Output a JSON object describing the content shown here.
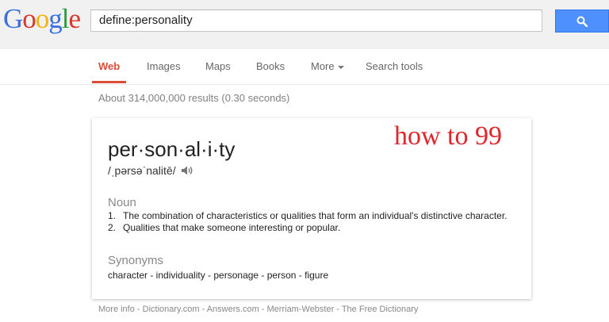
{
  "logo": {
    "text": "Google",
    "letters": [
      {
        "char": "G",
        "color": "#3b6fe0"
      },
      {
        "char": "o",
        "color": "#d9382d"
      },
      {
        "char": "o",
        "color": "#f2b50f"
      },
      {
        "char": "g",
        "color": "#3b6fe0"
      },
      {
        "char": "l",
        "color": "#2a9d3d"
      },
      {
        "char": "e",
        "color": "#d9382d"
      }
    ]
  },
  "search": {
    "query": "define:personality",
    "button_icon": "search-icon"
  },
  "tabs": [
    {
      "label": "Web",
      "active": true
    },
    {
      "label": "Images",
      "active": false
    },
    {
      "label": "Maps",
      "active": false
    },
    {
      "label": "Books",
      "active": false
    },
    {
      "label": "More",
      "active": false,
      "icon": "caret-down-icon"
    },
    {
      "label": "Search tools",
      "active": false
    }
  ],
  "result_stats": "About 314,000,000 results (0.30 seconds)",
  "definition": {
    "word": "per·son·al·i·ty",
    "pronunciation": "/ˌpərsəˈnalitē/",
    "speaker_icon": "speaker-icon",
    "part_of_speech": "Noun",
    "definitions": [
      {
        "num": "1.",
        "text": "The combination of characteristics or qualities that form an individual's distinctive character."
      },
      {
        "num": "2.",
        "text": "Qualities that make someone interesting or popular."
      }
    ],
    "synonyms_label": "Synonyms",
    "synonyms": "character - individuality - personage - person - figure"
  },
  "overlay_text": "how to 99",
  "footer": "More info - Dictionary.com - Answers.com - Merriam-Webster - The Free Dictionary",
  "colors": {
    "accent_red": "#dd4b39",
    "search_button": "#4d90fe"
  }
}
